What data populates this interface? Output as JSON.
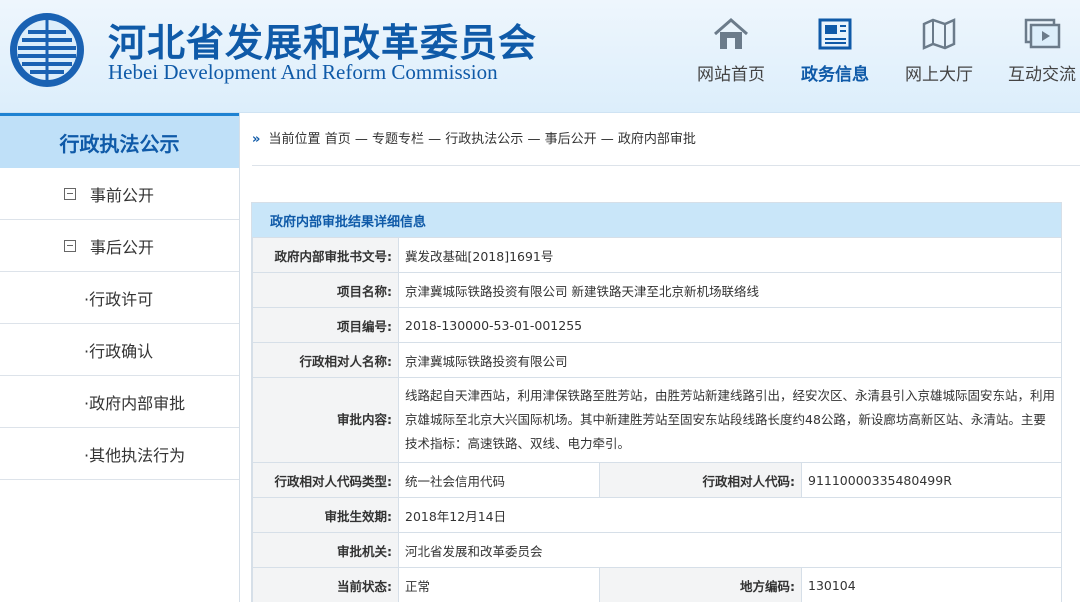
{
  "site": {
    "title_cn": "河北省发展和改革委员会",
    "title_en": "Hebei Development And Reform Commission"
  },
  "nav": [
    {
      "label": "网站首页",
      "icon": "house-icon",
      "active": false
    },
    {
      "label": "政务信息",
      "icon": "document-icon",
      "active": true
    },
    {
      "label": "网上大厅",
      "icon": "map-icon",
      "active": false
    },
    {
      "label": "互动交流",
      "icon": "video-icon",
      "active": false
    }
  ],
  "sidebar": {
    "title": "行政执法公示",
    "items": [
      {
        "label": "事前公开",
        "type": "group"
      },
      {
        "label": "事后公开",
        "type": "group"
      },
      {
        "label": "·行政许可",
        "type": "sub"
      },
      {
        "label": "·行政确认",
        "type": "sub"
      },
      {
        "label": "·政府内部审批",
        "type": "sub"
      },
      {
        "label": "·其他执法行为",
        "type": "sub"
      }
    ]
  },
  "breadcrumb": {
    "prefix": "当前位置",
    "items": [
      "首页",
      "专题专栏",
      "行政执法公示",
      "事后公开",
      "政府内部审批"
    ],
    "separator": "—"
  },
  "detail": {
    "heading": "政府内部审批结果详细信息",
    "doc_no_label": "政府内部审批书文号:",
    "doc_no": "冀发改基础[2018]1691号",
    "project_name_label": "项目名称:",
    "project_name": "京津冀城际铁路投资有限公司 新建铁路天津至北京新机场联络线",
    "project_code_label": "项目编号:",
    "project_code": "2018-130000-53-01-001255",
    "counterpart_name_label": "行政相对人名称:",
    "counterpart_name": "京津冀城际铁路投资有限公司",
    "content_label": "审批内容:",
    "content": "线路起自天津西站，利用津保铁路至胜芳站，由胜芳站新建线路引出，经安次区、永清县引入京雄城际固安东站，利用京雄城际至北京大兴国际机场。其中新建胜芳站至固安东站段线路长度约48公路，新设廊坊高新区站、永清站。主要技术指标：高速铁路、双线、电力牵引。",
    "code_type_label": "行政相对人代码类型:",
    "code_type": "统一社会信用代码",
    "code_label": "行政相对人代码:",
    "code": "91110000335480499R",
    "effective_label": "审批生效期:",
    "effective": "2018年12月14日",
    "authority_label": "审批机关:",
    "authority": "河北省发展和改革委员会",
    "status_label": "当前状态:",
    "status": "正常",
    "region_label": "地方编码:",
    "region": "130104"
  }
}
